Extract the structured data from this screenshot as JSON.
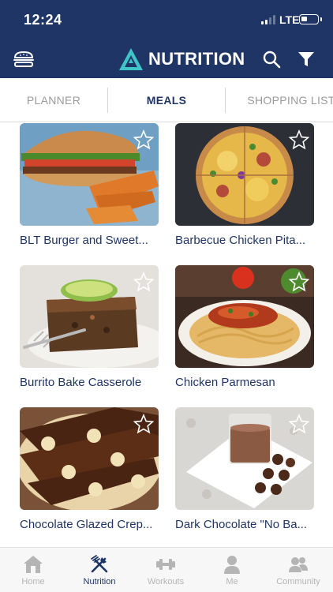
{
  "status_bar": {
    "time": "12:24",
    "network": "LTE"
  },
  "header": {
    "title": "NUTRITION",
    "menu_icon": "burger-menu-icon",
    "search_icon": "search-icon",
    "filter_icon": "filter-icon",
    "colors": {
      "background": "#1f3566",
      "logo_accent": "#3fc4c8"
    }
  },
  "tabs": [
    {
      "label": "PLANNER",
      "active": false
    },
    {
      "label": "MEALS",
      "active": true
    },
    {
      "label": "SHOPPING LIST",
      "active": false
    }
  ],
  "meals": [
    {
      "name": "BLT Burger and Sweet...",
      "favorite": false
    },
    {
      "name": "Barbecue Chicken Pita...",
      "favorite": false
    },
    {
      "name": "Burrito Bake Casserole",
      "favorite": false
    },
    {
      "name": "Chicken Parmesan",
      "favorite": false
    },
    {
      "name": "Chocolate Glazed Crep...",
      "favorite": false
    },
    {
      "name": "Dark Chocolate \"No Ba...",
      "favorite": false
    }
  ],
  "bottom_nav": [
    {
      "label": "Home",
      "icon": "home-icon",
      "active": false
    },
    {
      "label": "Nutrition",
      "icon": "fork-knife-icon",
      "active": true
    },
    {
      "label": "Workouts",
      "icon": "dumbbell-icon",
      "active": false
    },
    {
      "label": "Me",
      "icon": "person-icon",
      "active": false
    },
    {
      "label": "Community",
      "icon": "community-icon",
      "active": false
    }
  ]
}
